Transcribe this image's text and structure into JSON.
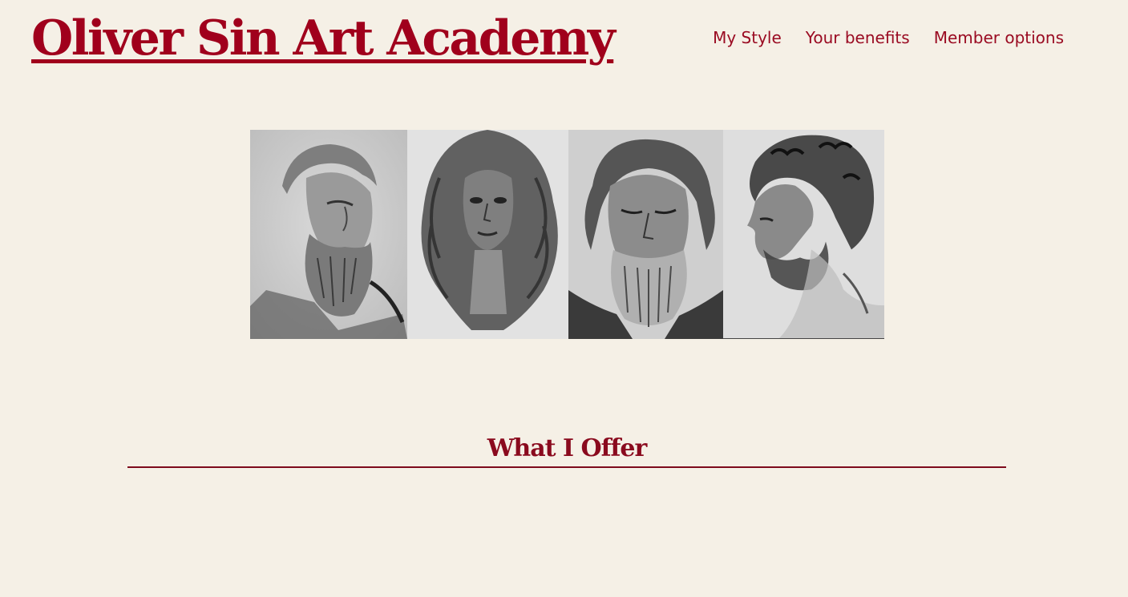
{
  "header": {
    "site_title": "Oliver Sin Art Academy",
    "nav": [
      {
        "label": "My Style"
      },
      {
        "label": "Your benefits"
      },
      {
        "label": "Member options"
      }
    ]
  },
  "gallery": {
    "portraits": [
      {
        "icon": "bearded-old-man-portrait-drawing"
      },
      {
        "icon": "woman-long-hair-portrait-drawing"
      },
      {
        "icon": "old-man-eyes-closed-portrait-drawing"
      },
      {
        "icon": "man-profile-portrait-drawing"
      }
    ]
  },
  "main": {
    "section_title": "What I Offer"
  },
  "colors": {
    "accent": "#a0001c",
    "background": "#f5f0e6"
  }
}
